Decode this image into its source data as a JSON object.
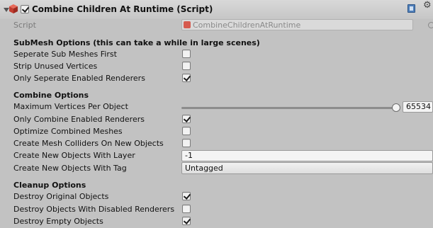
{
  "header": {
    "title": "Combine Children At Runtime (Script)",
    "enabled": true
  },
  "script": {
    "label": "Script",
    "value": "CombineChildrenAtRuntime"
  },
  "submesh": {
    "title": "SubMesh Options   (this can take a while in large scenes)",
    "seperate_label": "Seperate Sub Meshes First",
    "seperate_checked": false,
    "strip_label": "Strip Unused Vertices",
    "strip_checked": false,
    "only_seperate_label": "Only Seperate Enabled Renderers",
    "only_seperate_checked": true
  },
  "combine": {
    "title": "Combine Options",
    "max_vertices_label": "Maximum Vertices Per Object",
    "max_vertices_value": "65534",
    "only_combine_label": "Only Combine Enabled Renderers",
    "only_combine_checked": true,
    "optimize_label": "Optimize Combined Meshes",
    "optimize_checked": false,
    "colliders_label": "Create Mesh Colliders On New Objects",
    "colliders_checked": false,
    "layer_label": "Create New Objects With Layer",
    "layer_value": "-1",
    "tag_label": "Create New Objects With Tag",
    "tag_value": "Untagged"
  },
  "cleanup": {
    "title": "Cleanup Options",
    "destroy_original_label": "Destroy Original Objects",
    "destroy_original_checked": true,
    "destroy_disabled_label": "Destroy Objects With Disabled Renderers",
    "destroy_disabled_checked": false,
    "destroy_empty_label": "Destroy Empty Objects",
    "destroy_empty_checked": true
  },
  "icons": {
    "foldout": "foldout-arrow-icon",
    "component": "cube-icon",
    "help": "book-icon",
    "settings": "gear-icon",
    "script": "script-icon",
    "target": "target-icon"
  }
}
